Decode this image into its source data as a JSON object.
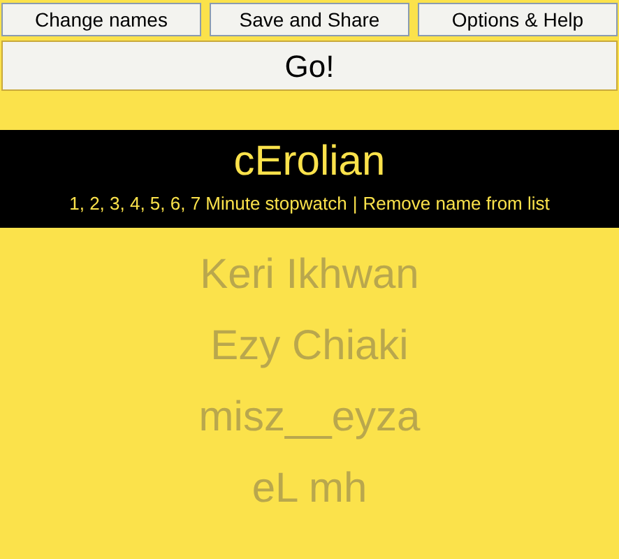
{
  "top_buttons": [
    "Change names",
    "Save and Share",
    "Options & Help"
  ],
  "go_button": "Go!",
  "banner": {
    "title": "cErolian",
    "links": [
      "1, 2, 3, 4, 5, 6, 7 Minute stopwatch",
      "Remove name from list"
    ],
    "separator": "|"
  },
  "names": [
    "Keri Ikhwan",
    "Ezy Chiaki",
    "misz__eyza",
    "eL mh"
  ]
}
